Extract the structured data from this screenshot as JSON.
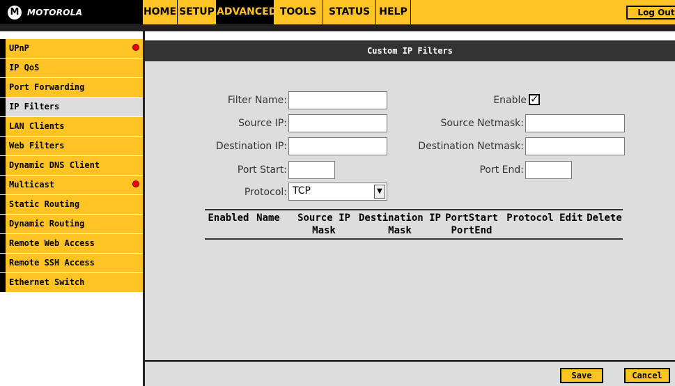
{
  "brand": {
    "name": "MOTOROLA",
    "logo_mark": "M"
  },
  "nav": {
    "items": [
      {
        "label": "HOME"
      },
      {
        "label": "SETUP"
      },
      {
        "label": "ADVANCED"
      },
      {
        "label": "TOOLS"
      },
      {
        "label": "STATUS"
      },
      {
        "label": "HELP"
      }
    ],
    "active": "ADVANCED",
    "logout_label": "Log Out"
  },
  "sidebar": {
    "items": [
      {
        "label": "UPnP",
        "alert": true
      },
      {
        "label": "IP QoS"
      },
      {
        "label": "Port Forwarding"
      },
      {
        "label": "IP Filters",
        "active": true
      },
      {
        "label": "LAN Clients"
      },
      {
        "label": "Web Filters"
      },
      {
        "label": "Dynamic DNS Client"
      },
      {
        "label": "Multicast",
        "alert": true
      },
      {
        "label": "Static Routing"
      },
      {
        "label": "Dynamic Routing"
      },
      {
        "label": "Remote Web Access"
      },
      {
        "label": "Remote SSH Access"
      },
      {
        "label": "Ethernet Switch"
      }
    ]
  },
  "page": {
    "title": "Custom IP Filters",
    "form": {
      "filter_name_label": "Filter Name:",
      "filter_name_value": "",
      "enable_label": "Enable",
      "enable_checked": true,
      "source_ip_label": "Source IP:",
      "source_ip_value": "",
      "source_netmask_label": "Source Netmask:",
      "source_netmask_value": "",
      "dest_ip_label": "Destination IP:",
      "dest_ip_value": "",
      "dest_netmask_label": "Destination Netmask:",
      "dest_netmask_value": "",
      "port_start_label": "Port Start:",
      "port_start_value": "",
      "port_end_label": "Port End:",
      "port_end_value": "",
      "protocol_label": "Protocol:",
      "protocol_value": "TCP"
    },
    "table": {
      "headers": [
        {
          "line1": "Enabled",
          "line2": ""
        },
        {
          "line1": "Name",
          "line2": ""
        },
        {
          "line1": "Source IP",
          "line2": "Mask"
        },
        {
          "line1": "Destination IP",
          "line2": "Mask"
        },
        {
          "line1": "PortStart",
          "line2": "PortEnd"
        },
        {
          "line1": "Protocol",
          "line2": ""
        },
        {
          "line1": "Edit",
          "line2": ""
        },
        {
          "line1": "Delete",
          "line2": ""
        }
      ],
      "rows": []
    }
  },
  "footer": {
    "save_label": "Save",
    "cancel_label": "Cancel"
  },
  "colors": {
    "accent": "#ffc423",
    "dark": "#000000",
    "panel": "#dddddd",
    "alert": "#ee0000"
  }
}
